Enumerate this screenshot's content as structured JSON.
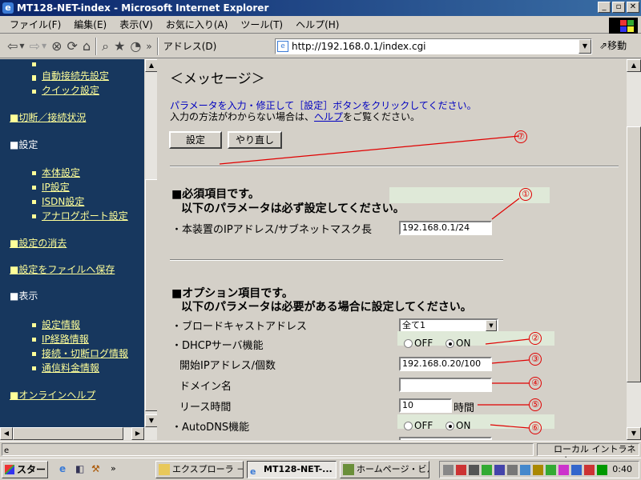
{
  "window": {
    "title": "MT128-NET-index - Microsoft Internet Explorer"
  },
  "menu": [
    "ファイル(F)",
    "編集(E)",
    "表示(V)",
    "お気に入り(A)",
    "ツール(T)",
    "ヘルプ(H)"
  ],
  "toolbar": {
    "address_label": "アドレス(D)",
    "url": "http://192.168.0.1/index.cgi",
    "go_label": "移動",
    "chevron": "»"
  },
  "sidebar": {
    "sub_top": [
      "自動接続先設定",
      "クイック設定"
    ],
    "head_connection": "■切断／接続状況",
    "head_settings": "■設定",
    "settings_items": [
      "本体設定",
      "IP設定",
      "ISDN設定",
      "アナログポート設定"
    ],
    "head_erase": "■設定の消去",
    "head_save": "■設定をファイルへ保存",
    "head_display": "■表示",
    "display_items": [
      "設定情報",
      "IP経路情報",
      "接続・切断ログ情報",
      "通信料金情報"
    ],
    "head_help": "■オンラインヘルプ"
  },
  "main": {
    "message_heading": "＜メッセージ＞",
    "msg_line1": "パラメータを入力・修正して［設定］ボタンをクリックしてください。",
    "msg_line2_pre": "入力の方法がわからない場合は、",
    "msg_line2_link": "ヘルプ",
    "msg_line2_post": "をご覧ください。",
    "set_button": "設定",
    "reset_button": "やり直し",
    "required_title": "■必須項目です。",
    "required_sub": "以下のパラメータは必ず設定してください。",
    "ip_label": "・本装置のIPアドレス/サブネットマスク長",
    "ip_value": "192.168.0.1/24",
    "optional_title": "■オプション項目です。",
    "optional_sub": "以下のパラメータは必要がある場合に設定してください。",
    "broadcast_label": "・ブロードキャストアドレス",
    "broadcast_value": "全て1",
    "dhcp_label": "・DHCPサーバ機能",
    "off_label": "OFF",
    "on_label": "ON",
    "start_ip_label": "開始IPアドレス/個数",
    "start_ip_value": "192.168.0.20/100",
    "domain_label": "ドメイン名",
    "domain_value": "",
    "lease_label": "リース時間",
    "lease_value": "10",
    "lease_unit": "時間",
    "autodns_label": "・AutoDNS機能",
    "annotations": [
      "①",
      "②",
      "③",
      "④",
      "⑤",
      "⑥",
      "⑦"
    ]
  },
  "status": {
    "zone": "ローカル イントラネット"
  },
  "taskbar": {
    "start": "スタート",
    "tasks": [
      "エクスプローラ － ...",
      "MT128-NET-...",
      "ホームページ・ビルダ..."
    ],
    "clock": "0:40"
  },
  "colors": {
    "sidebar_bg": "#17375e",
    "link_yellow": "#ffff99",
    "annotation_red": "#e00000",
    "text_blue": "#0000c0"
  }
}
